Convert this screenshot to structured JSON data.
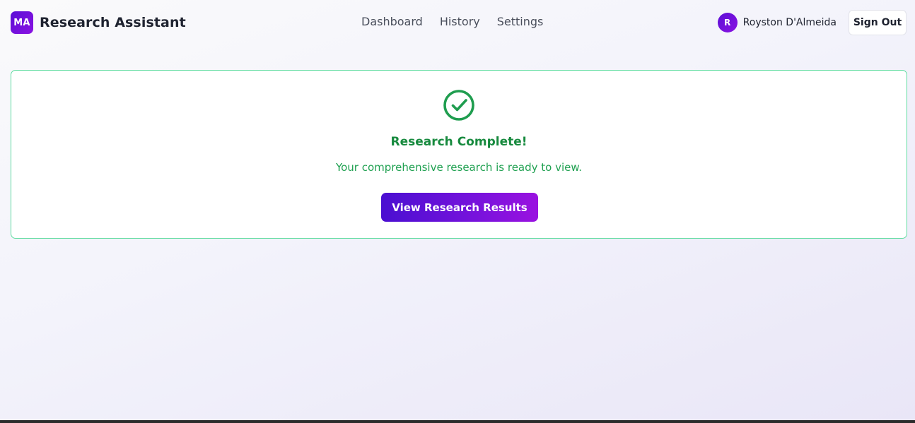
{
  "brand": {
    "logo_text": "MA",
    "name": "Research Assistant"
  },
  "nav": {
    "items": [
      {
        "label": "Dashboard"
      },
      {
        "label": "History"
      },
      {
        "label": "Settings"
      }
    ]
  },
  "user": {
    "avatar_initial": "R",
    "name": "Royston D'Almeida",
    "sign_out_label": "Sign Out"
  },
  "status_card": {
    "icon": "check-circle-icon",
    "title": "Research Complete!",
    "message": "Your comprehensive research is ready to view.",
    "button_label": "View Research Results"
  },
  "colors": {
    "accent": "#6a11d9",
    "success": "#1f9d4f",
    "success_border": "#5fdca0"
  }
}
